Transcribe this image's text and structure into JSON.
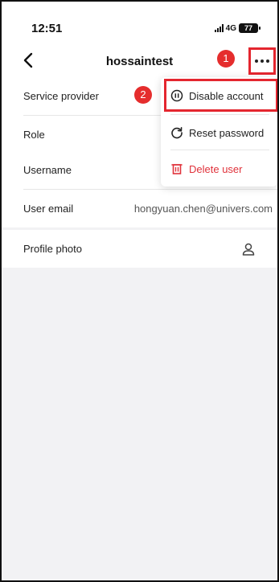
{
  "status_bar": {
    "time": "12:51",
    "network": "4G",
    "battery": "77"
  },
  "nav": {
    "title": "hossaintest",
    "back_icon": "chevron-left-icon",
    "more_icon": "more-horizontal-icon"
  },
  "callouts": {
    "first": "1",
    "second": "2"
  },
  "details": {
    "service_provider_label": "Service provider",
    "role_label": "Role",
    "username_label": "Username",
    "user_email_label": "User email",
    "user_email_value": "hongyuan.chen@univers.com",
    "profile_photo_label": "Profile photo",
    "profile_photo_icon": "person-icon"
  },
  "menu": {
    "items": [
      {
        "label": "Disable account",
        "icon": "pause-circle-icon"
      },
      {
        "label": "Reset password",
        "icon": "refresh-icon"
      },
      {
        "label": "Delete user",
        "icon": "trash-icon",
        "color": "#e0323b"
      }
    ]
  },
  "colors": {
    "annotation": "#e4262f",
    "danger": "#e0323b",
    "background": "#f2f2f4"
  }
}
